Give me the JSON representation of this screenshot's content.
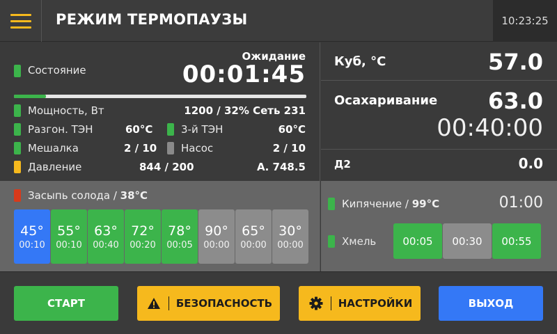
{
  "header": {
    "title": "РЕЖИМ ТЕРМОПАУЗЫ",
    "time": "10:23:25",
    "menu_icon": "hamburger-menu-icon"
  },
  "status": {
    "label": "Состояние",
    "state_text": "Ожидание",
    "timer": "00:01:45",
    "progress_fraction": 0.11
  },
  "rows": {
    "power": {
      "label": "Мощность, Вт",
      "value": "1200 / 32% Сеть 231"
    },
    "heater_boost": {
      "label": "Разгон. ТЭН",
      "value": "60°C"
    },
    "heater_3": {
      "label": "3-й ТЭН",
      "value": "60°C"
    },
    "mixer": {
      "label": "Мешалка",
      "value": "2 / 10"
    },
    "pump": {
      "label": "Насос",
      "value": "2 / 10"
    },
    "pressure": {
      "label": "Давление",
      "value": "844 / 200",
      "value2": "А. 748.5"
    }
  },
  "right": {
    "cube": {
      "label": "Куб, °C",
      "value": "57.0"
    },
    "saccharification": {
      "label": "Осахаривание",
      "value": "63.0",
      "timer": "00:40:00"
    },
    "d2": {
      "label": "Д2",
      "value": "0.0"
    }
  },
  "malt": {
    "label": "Засыпь солода / ",
    "temp": "38°C",
    "steps": [
      {
        "temp": "45°",
        "time": "00:10",
        "state": "active"
      },
      {
        "temp": "55°",
        "time": "00:10",
        "state": "done"
      },
      {
        "temp": "63°",
        "time": "00:40",
        "state": "done"
      },
      {
        "temp": "72°",
        "time": "00:20",
        "state": "done"
      },
      {
        "temp": "78°",
        "time": "00:05",
        "state": "done"
      },
      {
        "temp": "90°",
        "time": "00:00",
        "state": "off"
      },
      {
        "temp": "65°",
        "time": "00:00",
        "state": "off"
      },
      {
        "temp": "30°",
        "time": "00:00",
        "state": "off"
      }
    ]
  },
  "boil": {
    "label": "Кипячение / ",
    "temp": "99°C",
    "time": "01:00",
    "hops_label": "Хмель",
    "hops": [
      {
        "time": "00:05",
        "state": "on"
      },
      {
        "time": "00:30",
        "state": "off"
      },
      {
        "time": "00:55",
        "state": "on"
      }
    ]
  },
  "buttons": {
    "start": "СТАРТ",
    "safety": "БЕЗОПАСНОСТЬ",
    "settings": "НАСТРОЙКИ",
    "exit": "ВЫХОД"
  },
  "colors": {
    "green": "#3cb44b",
    "yellow": "#f6b91d",
    "blue": "#3478f6",
    "red": "#d83a1a",
    "gray": "#8c8c8c"
  }
}
